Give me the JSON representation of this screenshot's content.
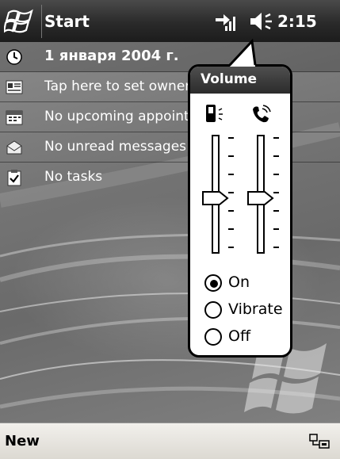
{
  "titlebar": {
    "start_label": "Start",
    "clock": "2:15"
  },
  "today": {
    "date": "1 января 2004 г.",
    "owner": "Tap here to set owner information",
    "appointments": "No upcoming appointments",
    "messages": "No unread messages",
    "tasks": "No tasks"
  },
  "volume": {
    "title": "Volume",
    "system_level": 0.45,
    "ringer_level": 0.45,
    "ring_modes": [
      {
        "label": "On",
        "selected": true
      },
      {
        "label": "Vibrate",
        "selected": false
      },
      {
        "label": "Off",
        "selected": false
      }
    ]
  },
  "menubar": {
    "new_label": "New"
  },
  "icons": {
    "start": "windows-flag-icon",
    "connectivity": "connectivity-icon",
    "speaker": "speaker-icon",
    "date": "clock-icon",
    "owner": "contact-card-icon",
    "calendar": "calendar-icon",
    "messages": "envelope-icon",
    "tasks": "clipboard-check-icon",
    "system_volume": "device-speaker-icon",
    "ringer_volume": "ringing-phone-icon",
    "input": "input-panel-icon"
  }
}
